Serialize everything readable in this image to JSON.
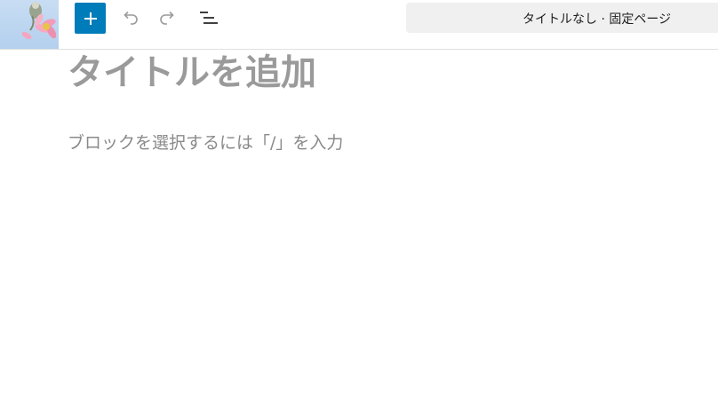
{
  "toolbar": {
    "site_logo": "site-logo-cosmos-flower",
    "inserter_icon": "plus-icon",
    "undo_icon": "undo-icon",
    "redo_icon": "redo-icon",
    "list_view_icon": "list-view-icon",
    "accent_color": "#007cba"
  },
  "document_bar": {
    "title": "タイトルなし · 固定ページ"
  },
  "editor": {
    "title_placeholder": "タイトルを追加",
    "block_placeholder": "ブロックを選択するには「/」を入力"
  }
}
